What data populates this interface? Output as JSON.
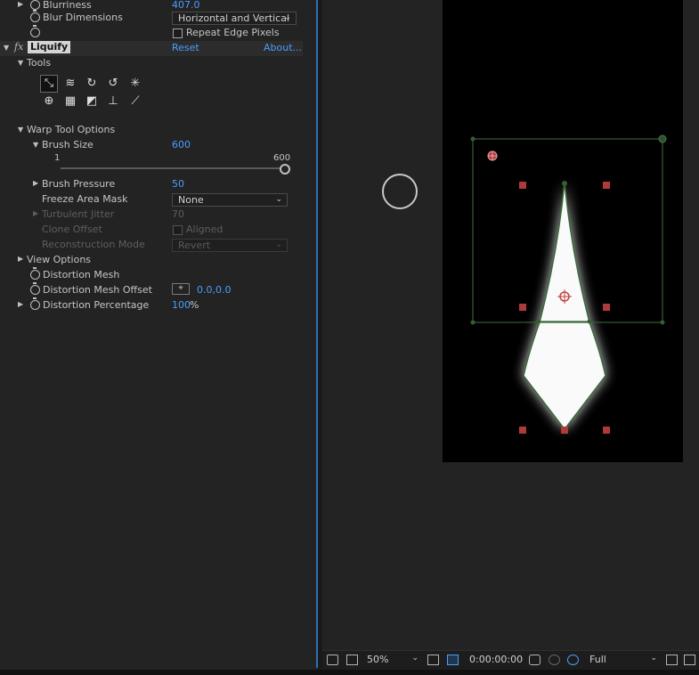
{
  "effects": {
    "gaussian_blur": {
      "blurriness_label": "Blurriness",
      "blurriness_value": "407.0",
      "blur_dimensions_label": "Blur Dimensions",
      "blur_dimensions_value": "Horizontal and Vertical",
      "repeat_edge_label": "Repeat Edge Pixels"
    },
    "liquify": {
      "fx_symbol": "fx",
      "name": "Liquify",
      "reset_label": "Reset",
      "about_label": "About...",
      "tools_label": "Tools",
      "warp_tool_options_label": "Warp Tool Options",
      "brush_size_label": "Brush Size",
      "brush_size_value": "600",
      "brush_size_min": "1",
      "brush_size_max": "600",
      "brush_pressure_label": "Brush Pressure",
      "brush_pressure_value": "50",
      "freeze_area_mask_label": "Freeze Area Mask",
      "freeze_area_mask_value": "None",
      "turbulent_jitter_label": "Turbulent Jitter",
      "turbulent_jitter_value": "70",
      "clone_offset_label": "Clone Offset",
      "aligned_label": "Aligned",
      "reconstruction_mode_label": "Reconstruction Mode",
      "reconstruction_mode_value": "Revert",
      "view_options_label": "View Options",
      "distortion_mesh_label": "Distortion Mesh",
      "distortion_mesh_offset_label": "Distortion Mesh Offset",
      "distortion_mesh_offset_value": "0.0,0.0",
      "distortion_percentage_label": "Distortion Percentage",
      "distortion_percentage_value": "100",
      "distortion_percentage_unit": "%"
    }
  },
  "viewer": {
    "zoom": "50%",
    "timecode": "0:00:00:00",
    "resolution": "Full"
  },
  "colors": {
    "accent": "#4a9eff",
    "panel_border": "#2d6fb8",
    "mask_path": "#3a6b3a",
    "handle": "#b03a3a"
  }
}
